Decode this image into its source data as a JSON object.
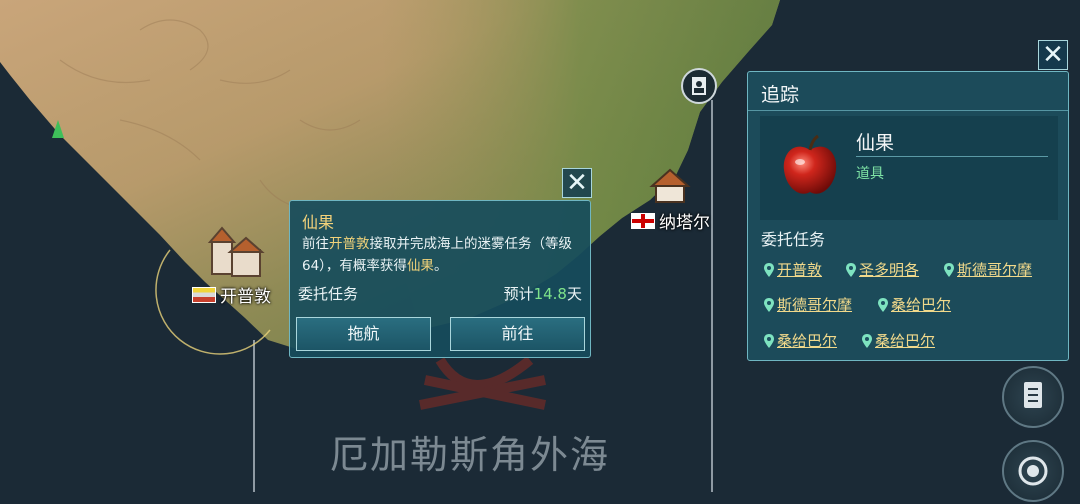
{
  "sea_name": "厄加勒斯角外海",
  "cities": [
    {
      "name": "开普敦",
      "flag": "capetown"
    },
    {
      "name": "纳塔尔",
      "flag": "natal"
    }
  ],
  "quest_popup": {
    "title": "仙果",
    "desc_parts": [
      "前往",
      "开普敦",
      "接取并完成海上的迷雾任务（等级64），有概率获得",
      "仙果",
      "。"
    ],
    "kind": "委托任务",
    "eta_prefix": "预计",
    "eta_value": "14.8",
    "eta_unit": "天",
    "buttons": {
      "tow": "拖航",
      "go": "前往"
    },
    "close_icon": "close-icon"
  },
  "tracking_panel": {
    "title": "追踪",
    "item": {
      "name": "仙果",
      "type": "道具",
      "icon": "apple-icon"
    },
    "section_label": "委托任务",
    "locations": [
      "开普敦",
      "圣多明各",
      "斯德哥尔摩",
      "斯德哥尔摩",
      "桑给巴尔",
      "桑给巴尔",
      "桑给巴尔"
    ],
    "close_icon": "close-icon"
  },
  "side_buttons": [
    "document-list-icon",
    "compass-coin-icon"
  ],
  "top_icon": "portrait-badge-icon",
  "colors": {
    "accent_gold": "#f0d27a",
    "accent_green": "#7ee38a",
    "panel_bg": "#1c5060",
    "sea": "#1b2a36"
  }
}
